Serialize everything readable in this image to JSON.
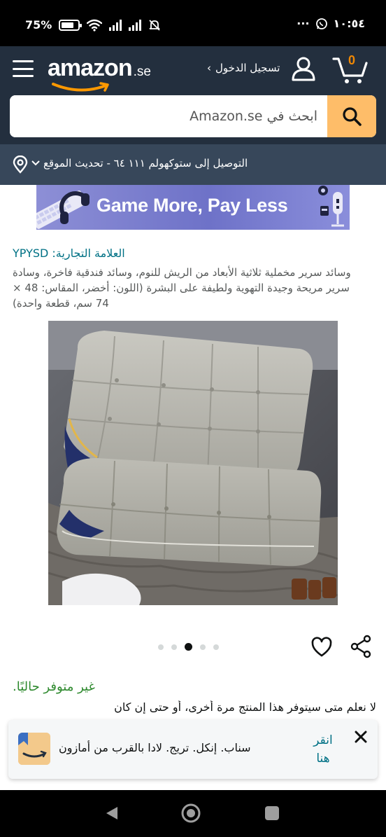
{
  "status_bar": {
    "battery": "75%",
    "battery_level": 0.75,
    "time": "١٠:٥٤",
    "icons": [
      "wifi-icon",
      "signal-icon",
      "signal-icon",
      "mute-icon",
      "whatsapp-icon",
      "more-icon",
      "battery-icon"
    ]
  },
  "header": {
    "logo_text": "amazon",
    "logo_tld": ".se",
    "signin_label": "تسجيل الدخول",
    "signin_arrow": "›",
    "cart_count": "0",
    "brand_color": "#232f3e",
    "accent_color": "#febd69"
  },
  "search": {
    "placeholder": "ابحث في Amazon.se"
  },
  "location": {
    "label": "التوصيل إلى ستوكهولم ١١١ ٦٤ - تحديث الموقع"
  },
  "banner": {
    "text": "Game More, Pay Less"
  },
  "product": {
    "brand": "العلامة التجارية: YPYSD",
    "title": "وسائد سرير مخملية ثلاثية الأبعاد من الريش للنوم، وسائد فندقية فاخرة، وسادة سرير مريحة وجيدة التهوية ولطيفة على البشرة (اللون: أخضر، المقاس: 48 × 74 سم، قطعة واحدة)",
    "image_count": 5,
    "active_image": 3,
    "availability": "غير متوفر حاليًا.",
    "availability_desc": "لا نعلم متى سيتوفر هذا المنتج مرة أخرى، أو حتى إن كان"
  },
  "app_promo": {
    "text": "سناب. إنكل. تريج. لادا بالقرب من أمازون",
    "cta": "انقر هنا",
    "close": "✕"
  }
}
